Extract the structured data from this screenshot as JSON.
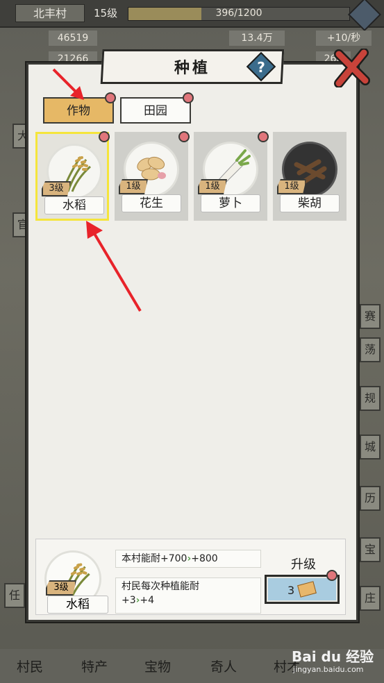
{
  "header": {
    "village_name": "北丰村",
    "level": "15级",
    "xp_text": "396/1200",
    "xp_fraction": 0.33,
    "stat_left_1": "46519",
    "stat_left_2": "21266",
    "stat_right_1": "13.4万",
    "stat_right_2": "+10/秒",
    "stat_right_3": "268"
  },
  "dialog": {
    "title": "种植",
    "help_label": "?",
    "tabs": [
      {
        "label": "作物",
        "active": true
      },
      {
        "label": "田园",
        "active": false
      }
    ],
    "crops": [
      {
        "name": "水稻",
        "level": "3级",
        "selected": true,
        "icon": "rice-icon"
      },
      {
        "name": "花生",
        "level": "1级",
        "selected": false,
        "icon": "peanut-icon"
      },
      {
        "name": "萝卜",
        "level": "1级",
        "selected": false,
        "icon": "radish-icon"
      },
      {
        "name": "柴胡",
        "level": "1级",
        "selected": false,
        "icon": "bupleurum-root-icon"
      }
    ],
    "detail": {
      "name": "水稻",
      "level": "3级",
      "stat1_prefix": "本村能耐+700",
      "stat1_next": "+800",
      "stat2_line1": "村民每次种植能耐",
      "stat2_prefix": "+3",
      "stat2_next": "+4",
      "upgrade_label": "升级",
      "upgrade_cost": "3"
    }
  },
  "side_buttons": [
    "大",
    "赛",
    "荡",
    "规",
    "城",
    "历",
    "宝",
    "庄",
    "任",
    "官"
  ],
  "bottom_nav": [
    "村民",
    "特产",
    "宝物",
    "奇人",
    "村才"
  ],
  "watermark": {
    "brand": "Bai du 经验",
    "url": "jingyan.baidu.com"
  },
  "colors": {
    "selected_border": "#f5e53b",
    "active_tab": "#e6b866",
    "notify_dot": "#e0767b",
    "upgrade_button": "#a9cce0"
  }
}
